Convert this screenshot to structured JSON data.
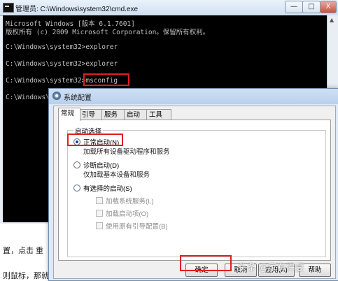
{
  "cmd_window": {
    "title": "管理员: C:\\Windows\\system32\\cmd.exe",
    "buttons": {
      "minimize": "—",
      "maximize": "□",
      "close": "X"
    },
    "lines": [
      "Microsoft Windows [版本 6.1.7601]",
      "版权所有 (c) 2009 Microsoft Corporation。保留所有权利。",
      "",
      "C:\\Windows\\system32>explorer",
      "",
      "C:\\Windows\\system32>explorer",
      "",
      "C:\\Windows\\system32>msconfig",
      "",
      "C:\\Windows\\"
    ]
  },
  "article_fragments": {
    "line1": "置，点击 重",
    "line2": "则鼠标，那就重"
  },
  "msconfig": {
    "title": "系统配置",
    "tabs": [
      "常规",
      "引导",
      "服务",
      "启动",
      "工具"
    ],
    "group_label": "启动选择",
    "options": [
      {
        "label": "正常启动(N)",
        "desc": "加载所有设备驱动程序和服务",
        "selected": true
      },
      {
        "label": "诊断启动(D)",
        "desc": "仅加载基本设备和服务",
        "selected": false
      },
      {
        "label": "有选择的启动(S)",
        "desc": "",
        "selected": false
      }
    ],
    "selective_items": [
      "加载系统服务(L)",
      "加载启动项(O)",
      "使用原有引导配置(B)"
    ],
    "buttons": {
      "ok": "确定",
      "cancel": "取消",
      "apply": "应用(A)",
      "help": "帮助"
    }
  },
  "watermark": "头条 @家有悍妻",
  "highlight_color": "#e02020"
}
